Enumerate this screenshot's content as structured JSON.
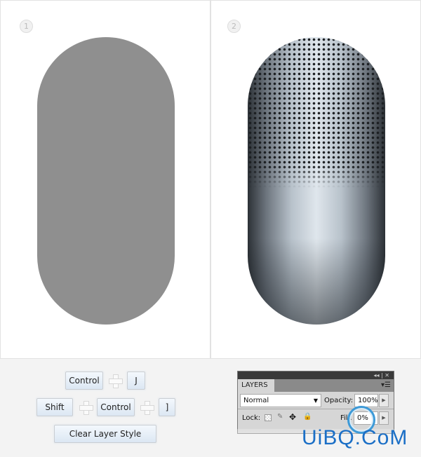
{
  "steps": [
    {
      "number": "1"
    },
    {
      "number": "2"
    }
  ],
  "colors": {
    "capsule_flat": "#8f8f8f",
    "accent_ring": "#3d9ad8",
    "watermark": "#1b6fc6"
  },
  "shortcuts": {
    "row1": [
      "Control",
      "J"
    ],
    "row2": [
      "Shift",
      "Control",
      "]"
    ],
    "clear_button": "Clear Layer Style"
  },
  "layers_panel": {
    "title_controls": "◂◂ | ✕",
    "tab": "LAYERS",
    "menu_icon": "menu-icon",
    "blend_mode": "Normal",
    "opacity_label": "Opacity:",
    "opacity_value": "100%",
    "lock_label": "Lock:",
    "fill_label": "Fill:",
    "fill_value": "0%"
  },
  "watermark": "UiBQ.CoM"
}
